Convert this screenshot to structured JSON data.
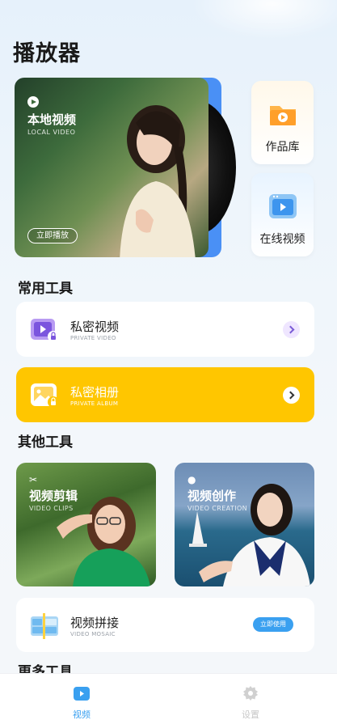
{
  "page": {
    "title": "播放器"
  },
  "hero": {
    "title": "本地视频",
    "subtitle": "LOCAL VIDEO",
    "button_label": "立即播放"
  },
  "side_cards": [
    {
      "label": "作品库",
      "icon": "folder-play-icon"
    },
    {
      "label": "在线视频",
      "icon": "online-video-icon"
    }
  ],
  "sections": {
    "common": "常用工具",
    "other": "其他工具",
    "more": "更多工具"
  },
  "common_tools": [
    {
      "title": "私密视频",
      "subtitle": "PRIVATE VIDEO",
      "icon": "private-video-icon"
    },
    {
      "title": "私密相册",
      "subtitle": "PRIVATE ALBUM",
      "icon": "private-album-icon",
      "accent": "#ffc600"
    }
  ],
  "other_tools": [
    {
      "title": "视频剪辑",
      "subtitle": "VIDEO CLIPS",
      "icon": "scissors-icon"
    },
    {
      "title": "视频创作",
      "subtitle": "VIDEO CREATION",
      "icon": "bulb-icon"
    }
  ],
  "mosaic": {
    "title": "视频拼接",
    "subtitle": "VIDEO MOSAIC",
    "button_label": "立即使用"
  },
  "tabs": [
    {
      "label": "视频",
      "active": true,
      "color": "#3aa0f0"
    },
    {
      "label": "设置",
      "active": false,
      "color": "#c8c8c8"
    }
  ]
}
